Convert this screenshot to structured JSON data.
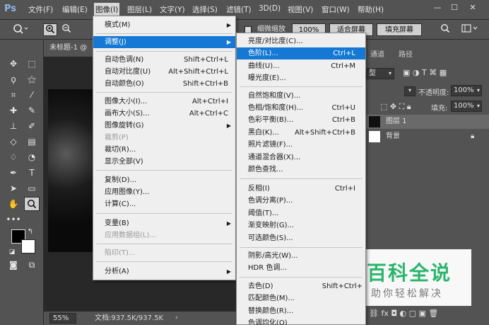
{
  "app": {
    "logo": "Ps"
  },
  "menubar": {
    "items": [
      "文件(F)",
      "编辑(E)",
      "图像(I)",
      "图层(L)",
      "文字(Y)",
      "选择(S)",
      "滤镜(T)",
      "3D(D)",
      "视图(V)",
      "窗口(W)",
      "帮助(H)"
    ],
    "window_controls": [
      "—",
      "☐",
      "✕"
    ]
  },
  "options_bar": {
    "checkbox_label": "细微缩放",
    "zoom_value": "100%",
    "fit_screen": "适合屏幕",
    "fill_screen": "填充屏幕"
  },
  "document": {
    "tab": "未标题-1 @",
    "zoom": "55%",
    "doc_info": "文档:937.5K/937.5K"
  },
  "panels": {
    "tabs": [
      "通道",
      "路径"
    ],
    "kind_label": "型",
    "opacity_label": "不透明度:",
    "opacity_value": "100%",
    "fill_label": "填充:",
    "fill_value": "100%",
    "layers": [
      {
        "name": "图层 1"
      },
      {
        "name": "背景"
      }
    ]
  },
  "image_menu": {
    "items": [
      {
        "label": "模式(M)",
        "shortcut": "",
        "submenu": true
      },
      {
        "label": "调整(J)",
        "shortcut": "",
        "submenu": true,
        "highlighted": true
      },
      {
        "label": "自动色调(N)",
        "shortcut": "Shift+Ctrl+L"
      },
      {
        "label": "自动对比度(U)",
        "shortcut": "Alt+Shift+Ctrl+L"
      },
      {
        "label": "自动颜色(O)",
        "shortcut": "Shift+Ctrl+B"
      },
      {
        "label": "图像大小(I)...",
        "shortcut": "Alt+Ctrl+I"
      },
      {
        "label": "画布大小(S)...",
        "shortcut": "Alt+Ctrl+C"
      },
      {
        "label": "图像旋转(G)",
        "shortcut": "",
        "submenu": true
      },
      {
        "label": "裁剪(P)",
        "shortcut": "",
        "disabled": true
      },
      {
        "label": "裁切(R)...",
        "shortcut": ""
      },
      {
        "label": "显示全部(V)",
        "shortcut": ""
      },
      {
        "label": "复制(D)...",
        "shortcut": ""
      },
      {
        "label": "应用图像(Y)...",
        "shortcut": ""
      },
      {
        "label": "计算(C)...",
        "shortcut": ""
      },
      {
        "label": "变量(B)",
        "shortcut": "",
        "submenu": true
      },
      {
        "label": "应用数据组(L)...",
        "shortcut": "",
        "disabled": true
      },
      {
        "label": "陷印(T)...",
        "shortcut": "",
        "disabled": true
      },
      {
        "label": "分析(A)",
        "shortcut": "",
        "submenu": true
      }
    ]
  },
  "adjust_menu": {
    "items": [
      {
        "label": "亮度/对比度(C)...",
        "shortcut": ""
      },
      {
        "label": "色阶(L)...",
        "shortcut": "Ctrl+L",
        "highlighted": true
      },
      {
        "label": "曲线(U)...",
        "shortcut": "Ctrl+M"
      },
      {
        "label": "曝光度(E)...",
        "shortcut": ""
      },
      {
        "label": "自然饱和度(V)...",
        "shortcut": ""
      },
      {
        "label": "色相/饱和度(H)...",
        "shortcut": "Ctrl+U"
      },
      {
        "label": "色彩平衡(B)...",
        "shortcut": "Ctrl+B"
      },
      {
        "label": "黑白(K)...",
        "shortcut": "Alt+Shift+Ctrl+B"
      },
      {
        "label": "照片滤镜(F)...",
        "shortcut": ""
      },
      {
        "label": "通道混合器(X)...",
        "shortcut": ""
      },
      {
        "label": "颜色查找...",
        "shortcut": ""
      },
      {
        "label": "反相(I)",
        "shortcut": "Ctrl+I"
      },
      {
        "label": "色调分离(P)...",
        "shortcut": ""
      },
      {
        "label": "阈值(T)...",
        "shortcut": ""
      },
      {
        "label": "渐变映射(G)...",
        "shortcut": ""
      },
      {
        "label": "可选颜色(S)...",
        "shortcut": ""
      },
      {
        "label": "阴影/高光(W)...",
        "shortcut": ""
      },
      {
        "label": "HDR 色调...",
        "shortcut": ""
      },
      {
        "label": "去色(D)",
        "shortcut": "Shift+Ctrl+"
      },
      {
        "label": "匹配颜色(M)...",
        "shortcut": ""
      },
      {
        "label": "替换颜色(R)...",
        "shortcut": ""
      },
      {
        "label": "色调均化(Q)",
        "shortcut": ""
      }
    ]
  },
  "watermark": {
    "title": "百科全说",
    "subtitle": "助你轻松解决"
  },
  "colors": {
    "highlight": "#1478d4",
    "watermark_green": "#2ab56b",
    "ui_dark": "#535353"
  }
}
